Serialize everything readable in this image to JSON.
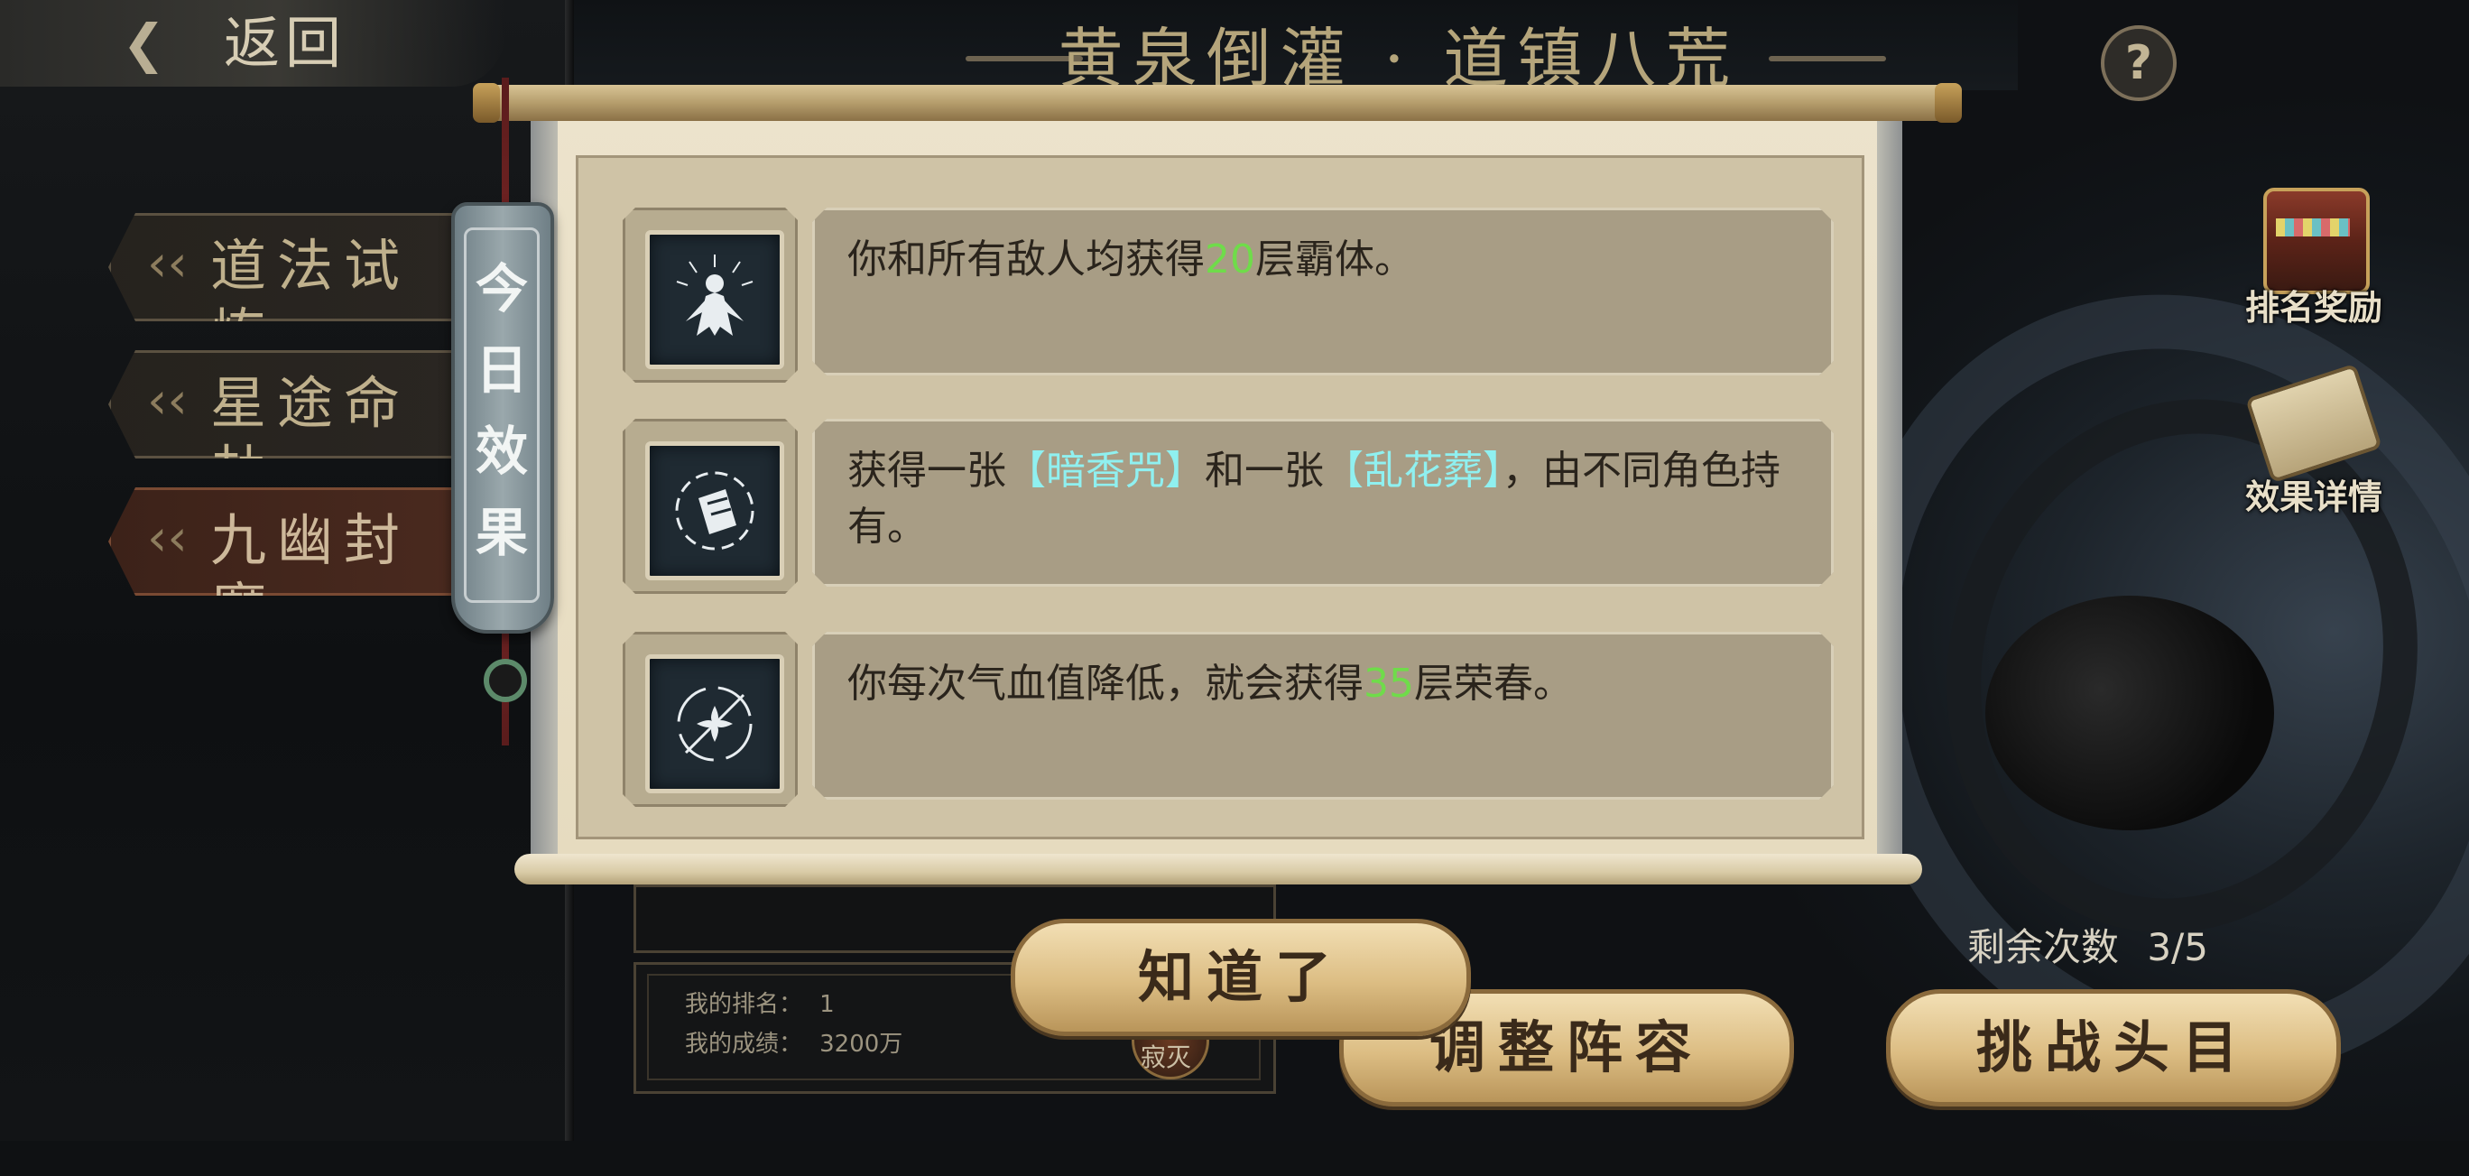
{
  "header": {
    "back_label": "返回",
    "back_icon": "swirl-back-icon",
    "title": "黄泉倒灌 · 道镇八荒",
    "help_icon": "question-icon",
    "help_label": "?"
  },
  "nav": {
    "items": [
      {
        "label": "道法试炼",
        "active": false
      },
      {
        "label": "星途命劫",
        "active": false
      },
      {
        "label": "九幽封魔",
        "active": true
      }
    ]
  },
  "side": {
    "ranking_rewards_label": "排名奖励",
    "ranking_rewards_icon": "treasure-chest-icon",
    "effect_details_label": "效果详情",
    "effect_details_icon": "scroll-icon"
  },
  "bottom": {
    "remaining_label": "剩余次数",
    "remaining_value": "3/5",
    "adjust_team_label": "调整阵容",
    "challenge_boss_label": "挑战头目",
    "my_rank_label": "我的排名：",
    "my_rank_value": "1",
    "my_score_label": "我的成绩：",
    "my_score_value": "3200万",
    "boss_name": "寂灭"
  },
  "modal": {
    "tag_text": "今日效果",
    "confirm_label": "知道了",
    "effects": [
      {
        "icon": "cloaked-figure-icon",
        "parts": [
          "你和所有敌人均获得",
          "20",
          "层霸体。"
        ]
      },
      {
        "icon": "talisman-card-icon",
        "parts": [
          "获得一张",
          "【暗香咒】",
          "和一张",
          "【乱花葬】",
          "，由不同角色持有。"
        ]
      },
      {
        "icon": "flower-sigil-icon",
        "parts": [
          "你每次气血值降低，就会获得",
          "35",
          "层荣春。"
        ]
      }
    ]
  },
  "colors": {
    "highlight_number": "#6fdc4a",
    "highlight_card": "#8ff0f0",
    "text_dark": "#2a241c"
  }
}
